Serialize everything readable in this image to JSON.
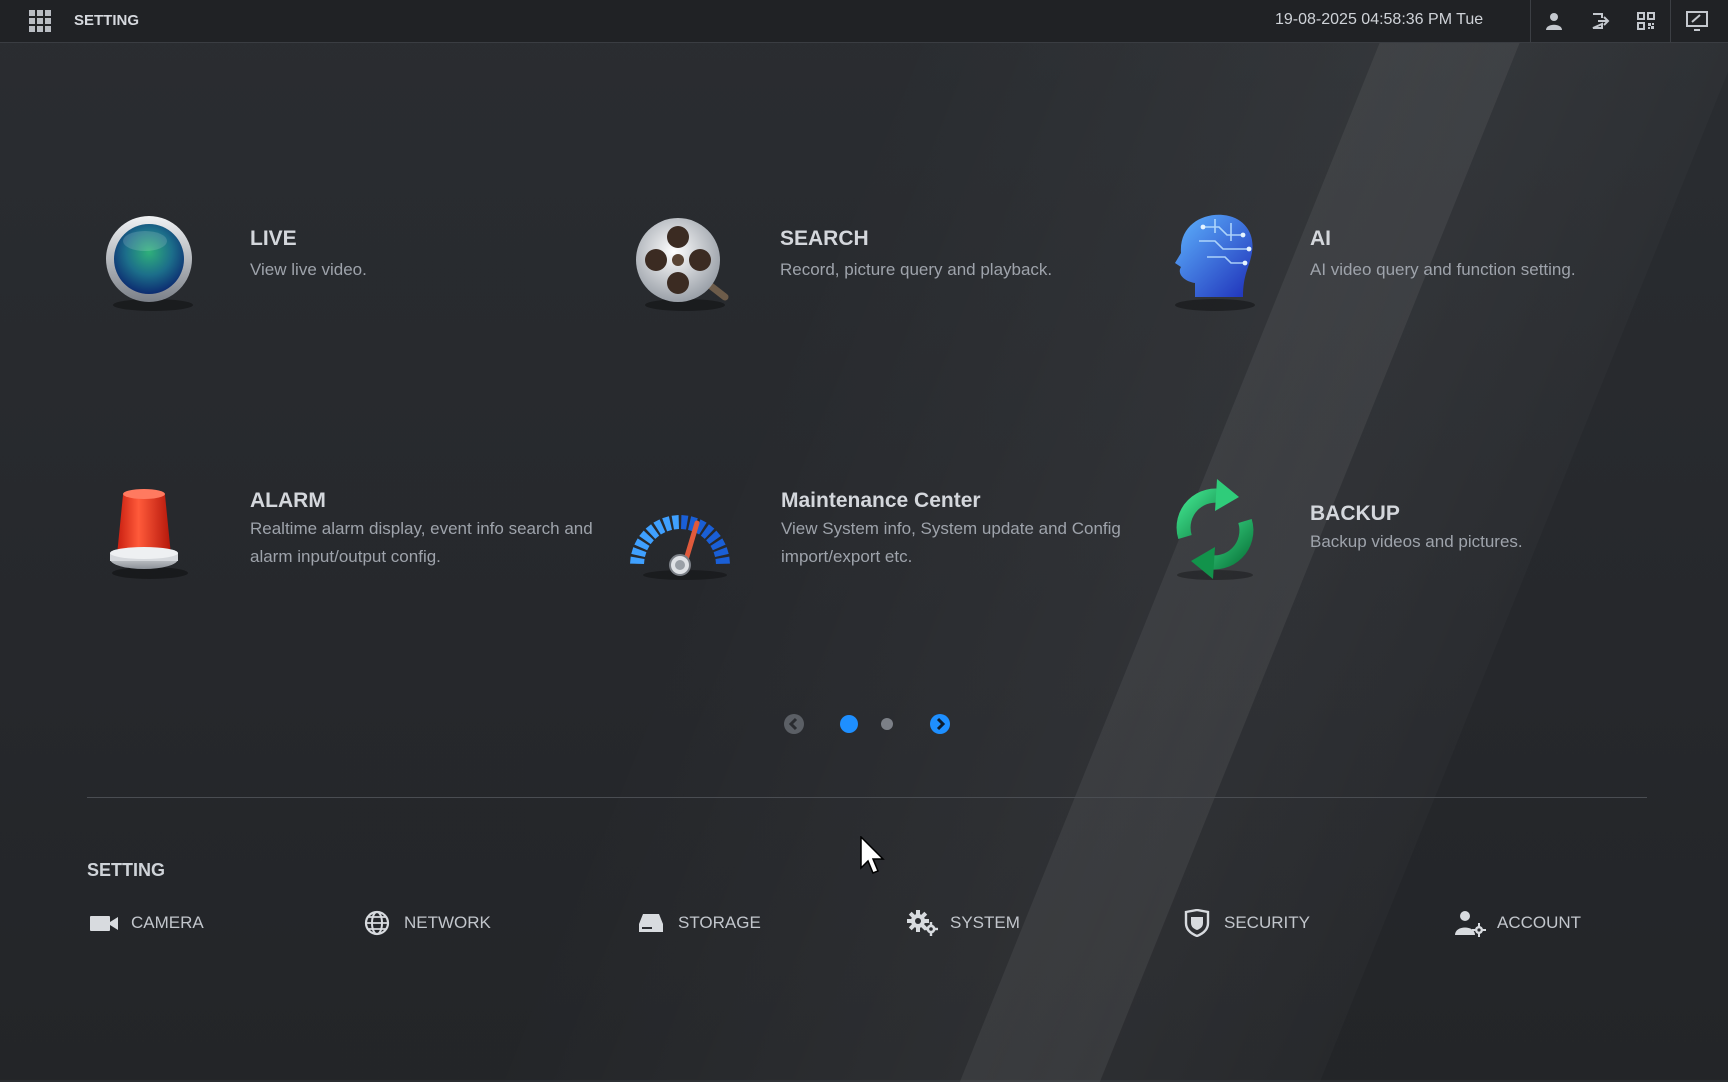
{
  "header": {
    "title": "SETTING",
    "datetime": "19-08-2025 04:58:36 PM Tue"
  },
  "tiles": [
    {
      "name": "LIVE",
      "desc": "View live video."
    },
    {
      "name": "SEARCH",
      "desc": "Record, picture query and playback."
    },
    {
      "name": "AI",
      "desc": "AI video query and function setting."
    },
    {
      "name": "ALARM",
      "desc": "Realtime alarm display, event info search and alarm input/output config."
    },
    {
      "name": "Maintenance Center",
      "desc": "View System info, System update and Config import/export etc."
    },
    {
      "name": "BACKUP",
      "desc": "Backup videos and pictures."
    }
  ],
  "pager": {
    "current_page": 1,
    "total_pages": 2
  },
  "settings": {
    "title": "SETTING",
    "items": [
      {
        "label": "CAMERA"
      },
      {
        "label": "NETWORK"
      },
      {
        "label": "STORAGE"
      },
      {
        "label": "SYSTEM"
      },
      {
        "label": "SECURITY"
      },
      {
        "label": "ACCOUNT"
      }
    ]
  },
  "colors": {
    "accent_blue": "#1e8fff",
    "header_bg": "#202225",
    "page_bg": "#26282c"
  }
}
